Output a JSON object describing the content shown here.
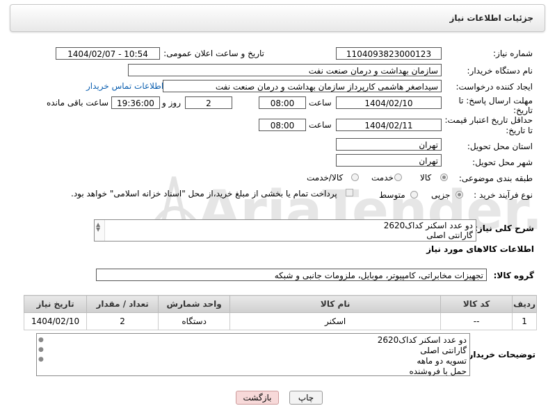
{
  "page": {
    "title": "جزئیات اطلاعات نیاز"
  },
  "need_number": {
    "label": "شماره نیاز:",
    "value": "1104093823000123"
  },
  "announce_datetime": {
    "label": "تاریخ و ساعت اعلان عمومی:",
    "value": "1404/02/07 - 10:54"
  },
  "buyer_org": {
    "label": "نام دستگاه خریدار:",
    "value": "سازمان بهداشت و درمان صنعت نفت"
  },
  "requester": {
    "label": "ایجاد کننده درخواست:",
    "value": "سیداصغر هاشمی کارپرداز سازمان بهداشت و درمان صنعت نفت",
    "contact_link": "اطلاعات تماس خریدار"
  },
  "response_deadline": {
    "label_line1": "مهلت ارسال پاسخ: تا",
    "label_line2": "تاریخ:",
    "date": "1404/02/10",
    "time_label": "ساعت",
    "time": "08:00",
    "days": "2",
    "days_label": "روز و",
    "remaining": "19:36:00",
    "remaining_label": "ساعت باقی مانده"
  },
  "price_validity": {
    "label_line1": "حداقل تاریخ اعتبار قیمت:",
    "label_line2": "تا تاریخ:",
    "date": "1404/02/11",
    "time_label": "ساعت",
    "time": "08:00"
  },
  "delivery_province": {
    "label": "استان محل تحویل:",
    "value": "تهران"
  },
  "delivery_city": {
    "label": "شهر محل تحویل:",
    "value": "تهران"
  },
  "category": {
    "label": "طبقه بندی موضوعی:",
    "options": [
      "کالا",
      "خدمت",
      "کالا/خدمت"
    ],
    "selected": "کالا"
  },
  "purchase_type": {
    "label": "نوع فرآیند خرید :",
    "options": [
      "جزیی",
      "متوسط"
    ],
    "selected": "جزیی",
    "payment_note": "پرداخت تمام یا بخشی از مبلغ خرید،از محل \"اسناد خزانه اسلامی\" خواهد بود."
  },
  "need_description": {
    "label": "شرح کلی نیاز:",
    "lines": [
      "دو عدد اسکنر کداک2620",
      "گارانتی اصلی"
    ]
  },
  "goods_info": {
    "label": "اطلاعات کالاهای مورد نیاز"
  },
  "goods_group": {
    "label": "گروه کالا:",
    "value": "تجهیزات مخابراتی، کامپیوتر، موبایل، ملزومات جانبی و شبکه"
  },
  "table": {
    "headers": [
      "ردیف",
      "کد کالا",
      "نام کالا",
      "واحد شمارش",
      "تعداد / مقدار",
      "تاریخ نیاز"
    ],
    "rows": [
      [
        "1",
        "--",
        "اسکنر",
        "دستگاه",
        "2",
        "1404/02/10"
      ]
    ]
  },
  "buyer_notes": {
    "label": "توضیحات خریدار:",
    "lines": [
      "دو عدد اسکنر کداک2620",
      "گارانتی اصلی",
      "تسویه دو ماهه",
      "حمل با فروشنده"
    ]
  },
  "buttons": {
    "print": "چاپ",
    "back": "بازگشت"
  },
  "watermark": {
    "text": "AriaTender.neT"
  },
  "colors": {
    "link": "#0b5fb0",
    "back_button_bg": "#f7d9d9",
    "print_button_bg": "#f3f3f3",
    "watermark": "#d9d9d9"
  }
}
